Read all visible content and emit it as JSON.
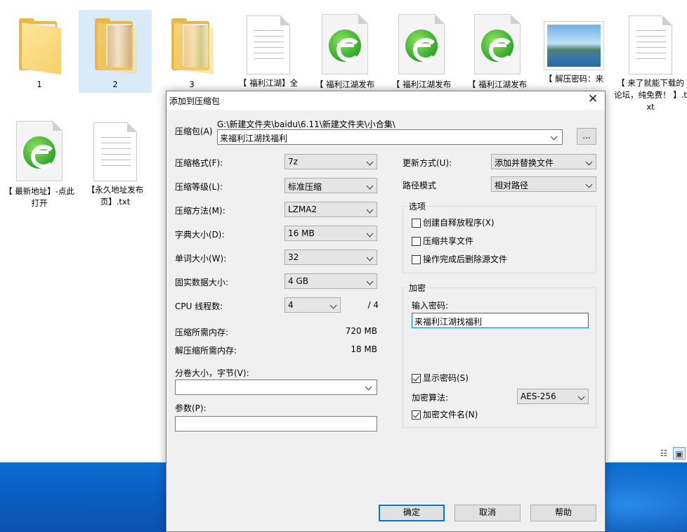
{
  "explorer": {
    "files": [
      {
        "label": "1"
      },
      {
        "label": "2"
      },
      {
        "label": "3"
      },
      {
        "label": "【 福利江湖】全"
      },
      {
        "label": "【 福利江湖发布"
      },
      {
        "label": "【 福利江湖发布"
      },
      {
        "label": "【 福利江湖发布"
      },
      {
        "label": "【 解压密码：来"
      },
      {
        "label": "【 来了就能下载的论坛，纯免费！ 】.txt"
      },
      {
        "label": "【 最新地址】-点此打开"
      },
      {
        "label": "【永久地址发布页】.txt"
      }
    ]
  },
  "dialog": {
    "title": "添加到压缩包",
    "archive_label": "压缩包(A)",
    "archive_path": "G:\\新建文件夹\\baidu\\6.11\\新建文件夹\\小合集\\",
    "archive_name": "来福利江湖找福利",
    "browse_label": "...",
    "format_label": "压缩格式(F):",
    "format_value": "7z",
    "level_label": "压缩等级(L):",
    "level_value": "标准压缩",
    "method_label": "压缩方法(M):",
    "method_value": "LZMA2",
    "dict_label": "字典大小(D):",
    "dict_value": "16 MB",
    "word_label": "单词大小(W):",
    "word_value": "32",
    "solid_label": "固实数据大小:",
    "solid_value": "4 GB",
    "cpu_label": "CPU 线程数:",
    "cpu_value": "4",
    "cpu_total": "/ 4",
    "mem_comp_label": "压缩所需内存:",
    "mem_comp_value": "720 MB",
    "mem_decomp_label": "解压缩所需内存:",
    "mem_decomp_value": "18 MB",
    "volume_label": "分卷大小，字节(V):",
    "volume_value": "",
    "params_label": "参数(P):",
    "params_value": "",
    "update_label": "更新方式(U):",
    "update_value": "添加并替换文件",
    "path_label": "路径模式",
    "path_value": "相对路径",
    "options_title": "选项",
    "opt_sfx": "创建自释放程序(X)",
    "opt_shared": "压缩共享文件",
    "opt_delete": "操作完成后删除源文件",
    "enc_title": "加密",
    "enc_pwd_label": "输入密码:",
    "enc_pwd_value": "来福利江湖找福利",
    "enc_show": "显示密码(S)",
    "enc_algo_label": "加密算法:",
    "enc_algo_value": "AES-256",
    "enc_names": "加密文件名(N)",
    "ok": "确定",
    "cancel": "取消",
    "help": "帮助"
  }
}
